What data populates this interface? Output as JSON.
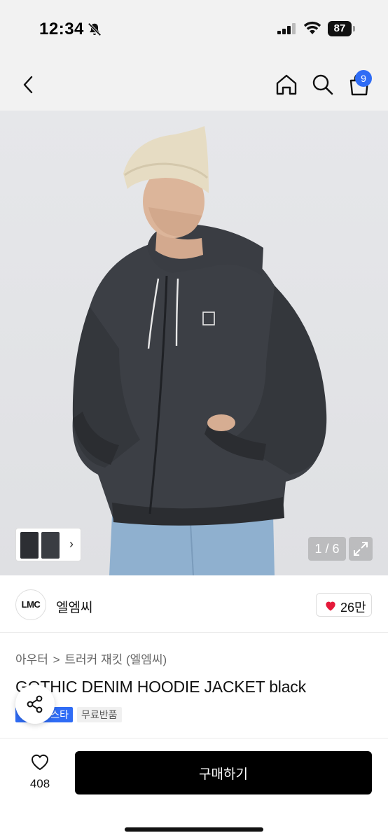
{
  "status_bar": {
    "time": "12:34",
    "battery": "87",
    "icons": [
      "bell-off-icon",
      "signal-icon",
      "wifi-icon",
      "battery-icon"
    ]
  },
  "header": {
    "icons": [
      "back-icon",
      "home-icon",
      "search-icon",
      "cart-icon"
    ],
    "cart_count": "9"
  },
  "gallery": {
    "counter": "1 / 6",
    "thumbnail_arrow": "›"
  },
  "brand": {
    "logo_text": "LMC",
    "name": "엘엠씨",
    "like_count": "26만",
    "like_color": "#e5193a"
  },
  "product": {
    "breadcrumb": [
      "아우터",
      ">",
      "트러커 재킷 (엘엠씨)"
    ],
    "title": "GOTHIC DENIM HOODIE JACKET black",
    "tags": [
      "스타",
      "무료반품"
    ],
    "tag_accent": "#2f6cf5"
  },
  "bottom_bar": {
    "wish_count": "408",
    "buy_label": "구매하기"
  }
}
